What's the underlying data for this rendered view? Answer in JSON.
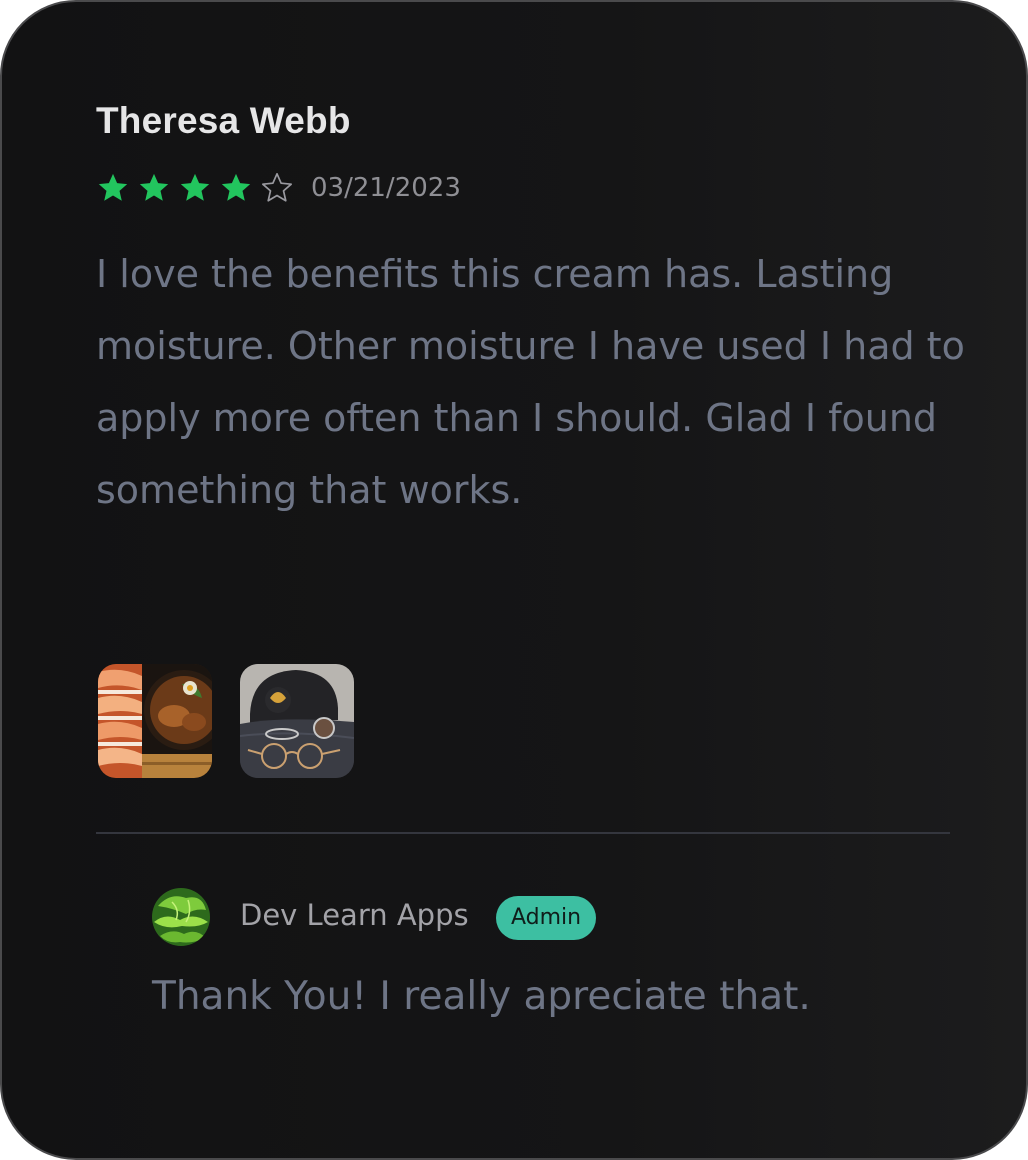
{
  "review": {
    "reviewer_name": "Theresa Webb",
    "rating": 4,
    "rating_max": 5,
    "star_color": "#22c55e",
    "date": "03/21/2023",
    "body": "I love the benefits this cream has. Lasting moisture. Other moisture I have used I had to apply more often than I should. Glad I found something that works.",
    "photos": [
      {
        "icon": "sushi-food-photo"
      },
      {
        "icon": "cap-glasses-photo"
      }
    ]
  },
  "reply": {
    "author": "Dev Learn Apps",
    "badge": "Admin",
    "badge_color": "#3dbfa2",
    "body": "Thank You! I really apreciate that."
  }
}
